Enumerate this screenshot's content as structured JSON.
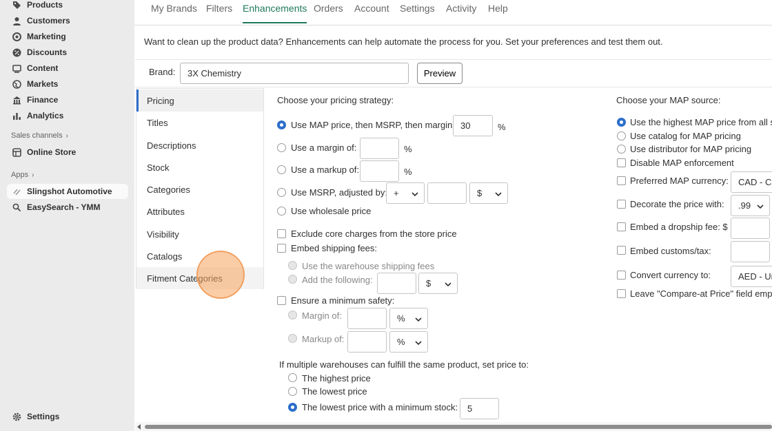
{
  "sidebar": {
    "items": [
      {
        "label": "Products",
        "icon": "tag-icon"
      },
      {
        "label": "Customers",
        "icon": "person-icon"
      },
      {
        "label": "Marketing",
        "icon": "target-icon"
      },
      {
        "label": "Discounts",
        "icon": "discount-icon"
      },
      {
        "label": "Content",
        "icon": "content-icon"
      },
      {
        "label": "Markets",
        "icon": "globe-icon"
      },
      {
        "label": "Finance",
        "icon": "bank-icon"
      },
      {
        "label": "Analytics",
        "icon": "bar-chart-icon"
      }
    ],
    "sales_channels_label": "Sales channels",
    "online_store": "Online Store",
    "apps_label": "Apps",
    "apps": [
      "Slingshot Automotive",
      "EasySearch - YMM"
    ],
    "settings": "Settings"
  },
  "tabs": [
    "My Brands",
    "Filters",
    "Enhancements",
    "Orders",
    "Account",
    "Settings",
    "Activity",
    "Help"
  ],
  "active_tab": "Enhancements",
  "intro": "Want to clean up the product data? Enhancements can help automate the process for you. Set your preferences and test them out.",
  "brand": {
    "label": "Brand:",
    "value": "3X Chemistry",
    "preview": "Preview"
  },
  "menu": [
    "Pricing",
    "Titles",
    "Descriptions",
    "Stock",
    "Categories",
    "Attributes",
    "Visibility",
    "Catalogs",
    "Fitment Categories"
  ],
  "pricing": {
    "heading": "Choose your pricing strategy:",
    "opt_map": "Use MAP price, then MSRP, then margin:",
    "opt_map_value": "30",
    "opt_margin": "Use a margin of:",
    "opt_markup": "Use a markup of:",
    "opt_msrp": "Use MSRP, adjusted by:",
    "msrp_sign": "+",
    "msrp_unit": "$",
    "opt_wholesale": "Use wholesale price",
    "pct": "%",
    "exclude_core": "Exclude core charges from the store price",
    "embed_shipping": "Embed shipping fees:",
    "use_warehouse": "Use the warehouse shipping fees",
    "add_following": "Add the following:",
    "add_unit": "$",
    "min_safety": "Ensure a minimum safety:",
    "margin_of": "Margin of:",
    "markup_of": "Markup of:",
    "safety_unit_1": "%",
    "safety_unit_2": "%",
    "multi_heading": "If multiple warehouses can fulfill the same product, set price to:",
    "highest": "The highest price",
    "lowest": "The lowest price",
    "lowest_stock": "The lowest price with a minimum stock:",
    "min_stock_value": "5"
  },
  "map": {
    "heading": "Choose your MAP source:",
    "highest": "Use the highest MAP price from all s",
    "catalog": "Use catalog for MAP pricing",
    "distributor": "Use distributor for MAP pricing",
    "disable": "Disable MAP enforcement",
    "preferred_currency": "Preferred MAP currency:",
    "currency_value": "CAD - Ca",
    "decorate": "Decorate the price with:",
    "decorate_value": ".99",
    "dropship": "Embed a dropship fee: $",
    "customs": "Embed customs/tax:",
    "convert": "Convert currency to:",
    "convert_value": "AED - Un",
    "compare_at": "Leave \"Compare-at Price\" field empt"
  },
  "colors": {
    "accent": "#2c6ecb",
    "active_tab": "#1f7a5a",
    "touch": "#f6a45f"
  }
}
